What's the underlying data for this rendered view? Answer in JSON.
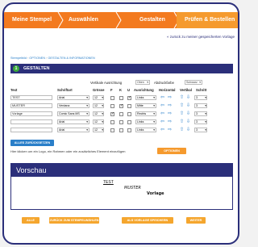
{
  "wizard": {
    "steps": [
      "Meine Stempel",
      "Auswählen",
      "Gestalten",
      "Prüfen & Bestellen"
    ]
  },
  "back_link": "« zurück zu meiner gespeicherten Vorlage",
  "breadcrumb": {
    "home": "Stempelbild",
    "items": [
      "OPTIONEN",
      "GESTALTEN & INFORMATIONEN"
    ]
  },
  "design": {
    "number": "1",
    "title": "GESTALTEN",
    "vertical_align_label": "Vertikale Ausrichtung",
    "vertical_align_value": "Oben",
    "border_label": "Abdruckfarbe",
    "border_value": "Schwarz",
    "columns": [
      "Text",
      "Schriftart",
      "Grösse",
      "F",
      "K",
      "U",
      "Ausrichtung",
      "Horizontal",
      "Vertikal",
      "Schritt"
    ],
    "rows": [
      {
        "text": "TEST",
        "font": "Arial",
        "size": "12",
        "bold": false,
        "italic": false,
        "underline": true,
        "align": "Links",
        "step": "3"
      },
      {
        "text": "MUSTER",
        "font": "Verdana",
        "size": "12",
        "bold": false,
        "italic": true,
        "underline": false,
        "align": "Mitte",
        "step": "3"
      },
      {
        "text": "Vorlage",
        "font": "Comic Sans MS",
        "size": "12",
        "bold": true,
        "italic": false,
        "underline": false,
        "align": "Rechts",
        "step": "3"
      },
      {
        "text": "",
        "font": "Arial",
        "size": "12",
        "bold": false,
        "italic": false,
        "underline": false,
        "align": "Links",
        "step": "3"
      },
      {
        "text": "",
        "font": "Arial",
        "size": "12",
        "bold": false,
        "italic": false,
        "underline": false,
        "align": "Links",
        "step": "3"
      }
    ],
    "reset_label": "ALLES ZURÜCKSETZEN",
    "logo_hint": "Hier klicken um ein Logo, ein Rahmen oder ein zusätzliches Element einzufügen",
    "options_label": "OPTIONEN"
  },
  "preview": {
    "title": "Vorschau",
    "lines": [
      "TEST",
      "MUSTER",
      "Vorlage"
    ]
  },
  "footer": {
    "buttons": [
      "ALLE",
      "ZURÜCK ZUM STEMPELWÄHLEN",
      "ALS VORLAGE SPEICHERN",
      "WEITER"
    ]
  },
  "colors": {
    "brand_orange": "#f37a1f",
    "navy": "#2b2f7a",
    "link_blue": "#2a7fc9"
  }
}
